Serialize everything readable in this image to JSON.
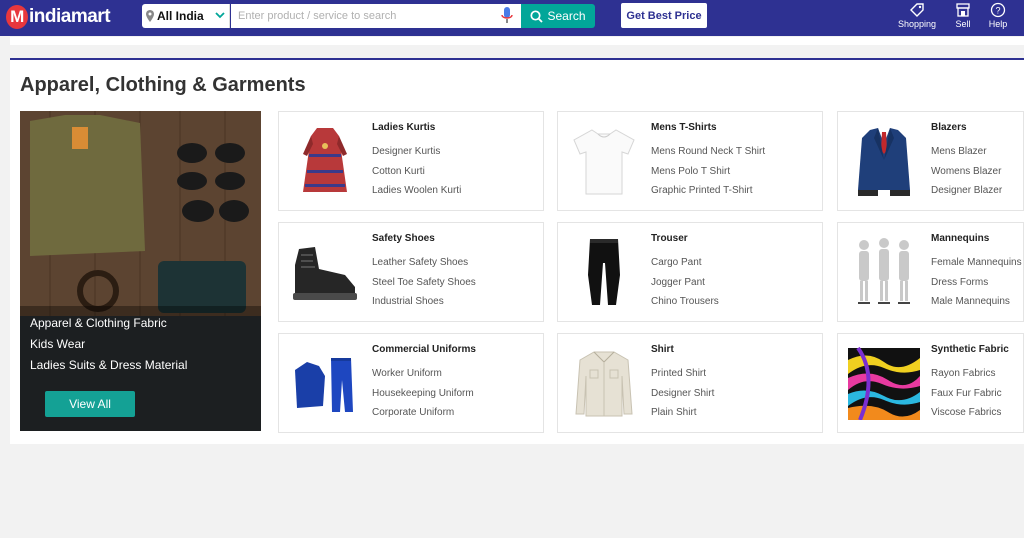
{
  "header": {
    "logo_text": "indiamart",
    "logo_letter": "M",
    "location": "All India",
    "search_placeholder": "Enter product / service to search",
    "search_button": "Search",
    "best_price_button": "Get Best Price",
    "nav": [
      {
        "label": "Shopping",
        "icon": "tag-icon"
      },
      {
        "label": "Sell",
        "icon": "store-icon"
      },
      {
        "label": "Help",
        "icon": "help-icon"
      }
    ]
  },
  "section": {
    "title": "Apparel, Clothing & Garments",
    "banner": {
      "links": [
        "Apparel & Clothing Fabric",
        "Kids Wear",
        "Ladies Suits & Dress Material"
      ],
      "view_all": "View All"
    },
    "categories": [
      {
        "title": "Ladies Kurtis",
        "items": [
          "Designer Kurtis",
          "Cotton Kurti",
          "Ladies Woolen Kurti"
        ],
        "icon": "kurti-image"
      },
      {
        "title": "Mens T-Shirts",
        "items": [
          "Mens Round Neck T Shirt",
          "Mens Polo T Shirt",
          "Graphic Printed T-Shirt"
        ],
        "icon": "tshirt-image"
      },
      {
        "title": "Blazers",
        "items": [
          "Mens Blazer",
          "Womens Blazer",
          "Designer Blazer"
        ],
        "icon": "blazer-image"
      },
      {
        "title": "Safety Shoes",
        "items": [
          "Leather Safety Shoes",
          "Steel Toe Safety Shoes",
          "Industrial Shoes"
        ],
        "icon": "shoe-image"
      },
      {
        "title": "Trouser",
        "items": [
          "Cargo Pant",
          "Jogger Pant",
          "Chino Trousers"
        ],
        "icon": "trouser-image"
      },
      {
        "title": "Mannequins",
        "items": [
          "Female Mannequins",
          "Dress Forms",
          "Male Mannequins"
        ],
        "icon": "mannequin-image"
      },
      {
        "title": "Commercial Uniforms",
        "items": [
          "Worker Uniform",
          "Housekeeping Uniform",
          "Corporate Uniform"
        ],
        "icon": "uniform-image"
      },
      {
        "title": "Shirt",
        "items": [
          "Printed Shirt",
          "Designer Shirt",
          "Plain Shirt"
        ],
        "icon": "shirt-image"
      },
      {
        "title": "Synthetic Fabric",
        "items": [
          "Rayon Fabrics",
          "Faux Fur Fabric",
          "Viscose Fabrics"
        ],
        "icon": "fabric-image"
      }
    ]
  },
  "colors": {
    "brand": "#2e3192",
    "accent": "#02a699",
    "logo_red": "#e8373d"
  }
}
